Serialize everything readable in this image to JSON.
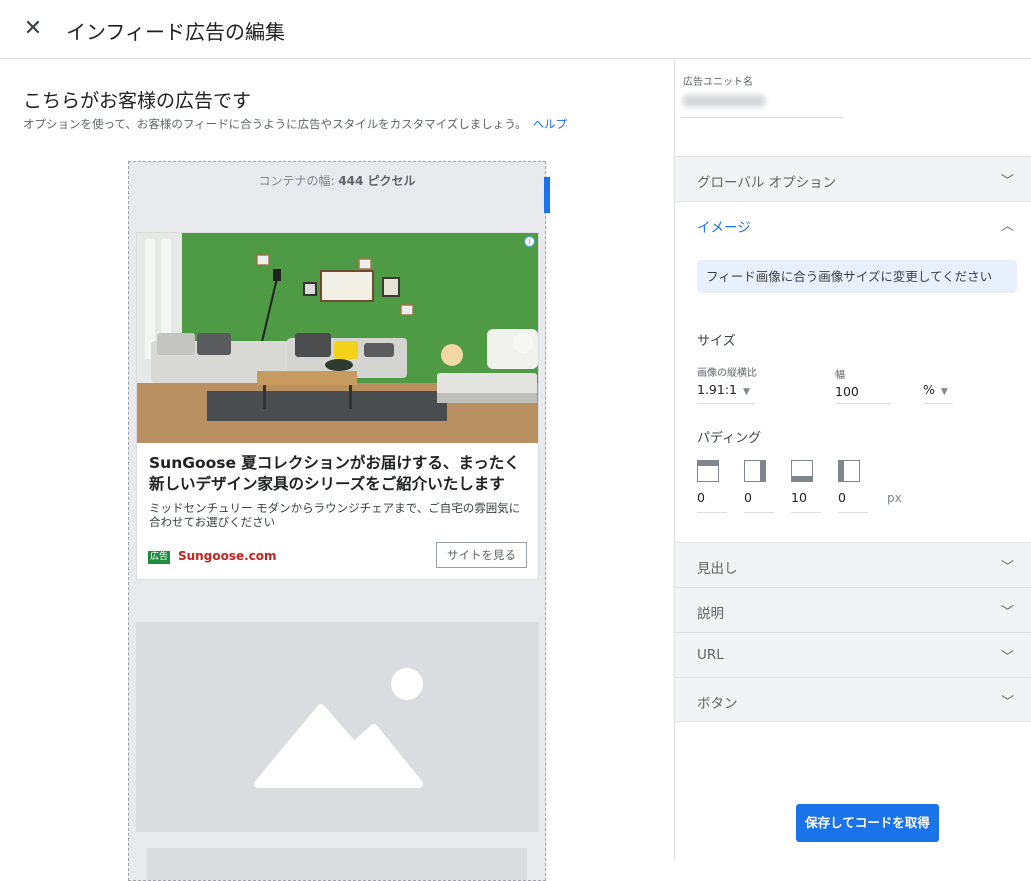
{
  "header": {
    "close_icon": "close-icon",
    "title": "インフィード広告の編集"
  },
  "lead": {
    "title": "こちらがお客様の広告です",
    "subtitle": "オプションを使って、お客様のフィードに合うように広告やスタイルをカスタマイズしましょう。",
    "help_link": "ヘルプ"
  },
  "preview": {
    "container_label_prefix": "コンテナの幅: ",
    "container_width": "444 ピクセル",
    "ad": {
      "info_icon": "info-icon",
      "headline": "SunGoose 夏コレクションがお届けする、まったく新しいデザイン家具のシリーズをご紹介いたします",
      "description": "ミッドセンチュリー モダンからラウンジチェアまで、ご自宅の雰囲気に合わせてお選びください",
      "badge": "広告",
      "url": "Sungoose.com",
      "cta": "サイトを見る"
    }
  },
  "panel": {
    "unit_name_label": "広告ユニット名",
    "sections": {
      "global": "グローバル オプション",
      "image": "イメージ",
      "headline": "見出し",
      "description": "説明",
      "url": "URL",
      "button": "ボタン"
    },
    "image_section": {
      "hint": "フィード画像に合う画像サイズに変更してください",
      "size_title": "サイズ",
      "ratio_label": "画像の縦横比",
      "ratio_value": "1.91:1",
      "width_label": "幅",
      "width_value": "100",
      "unit_value": "%",
      "padding_title": "パディング",
      "padding": [
        "0",
        "0",
        "10",
        "0"
      ],
      "padding_unit": "px"
    }
  },
  "footer": {
    "save_label": "保存してコードを取得"
  },
  "colors": {
    "accent": "#1a73e8",
    "ad_url": "#c5221f",
    "ad_badge": "#1e8e3e"
  }
}
